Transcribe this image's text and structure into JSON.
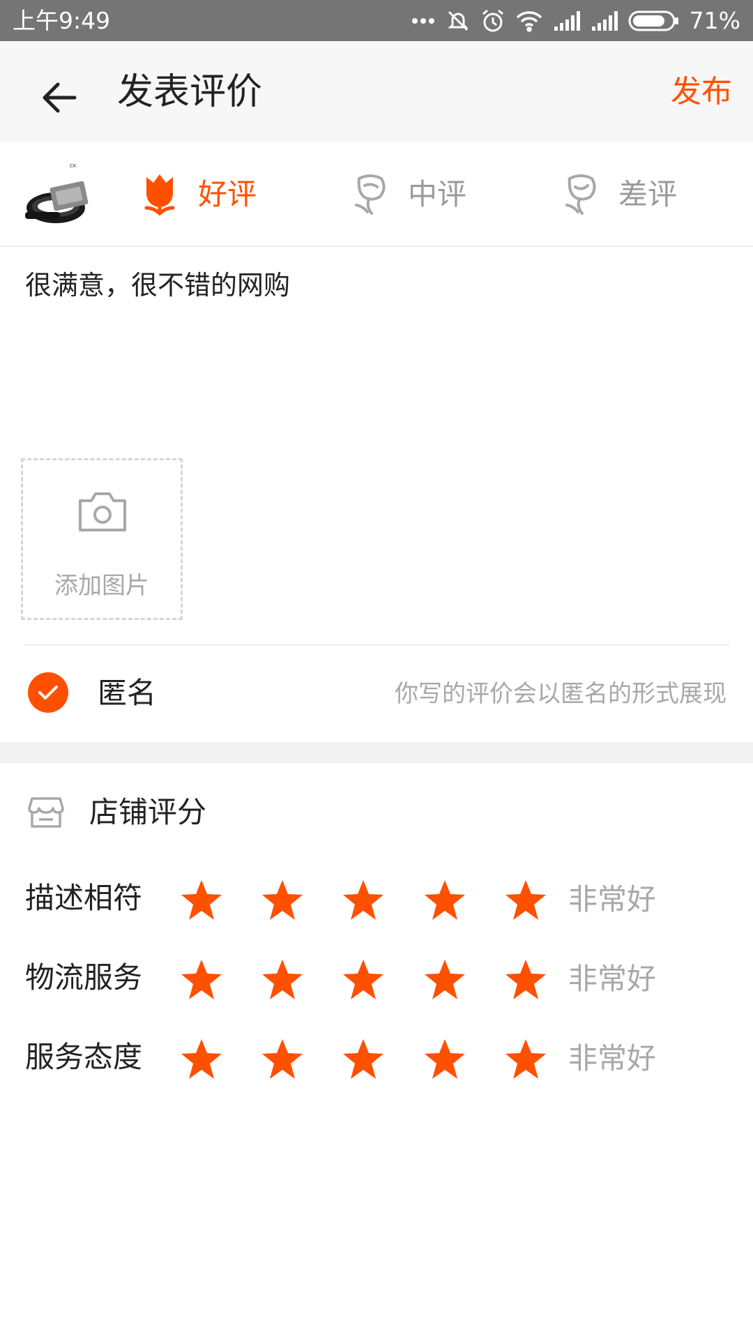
{
  "status_bar": {
    "time": "上午9:49",
    "battery": "71%",
    "icons": [
      "more-dots-icon",
      "mute-bell-icon",
      "alarm-icon",
      "wifi-icon",
      "signal-icon",
      "signal-icon",
      "battery-icon"
    ]
  },
  "header": {
    "title": "发表评价",
    "publish_label": "发布",
    "back_icon": "arrow-left-icon"
  },
  "rating_type": {
    "selected": "good",
    "good_label": "好评",
    "mid_label": "中评",
    "bad_label": "差评"
  },
  "product": {
    "image": "belt-product-thumbnail"
  },
  "comment": {
    "value": "很满意，很不错的网购"
  },
  "add_image": {
    "label": "添加图片"
  },
  "anonymous": {
    "checked": true,
    "label": "匿名",
    "hint": "你写的评价会以匿名的形式展现"
  },
  "shop_rating": {
    "title": "店铺评分",
    "items": [
      {
        "name": "描述相符",
        "stars": 5,
        "max": 5,
        "value_text": "非常好"
      },
      {
        "name": "物流服务",
        "stars": 5,
        "max": 5,
        "value_text": "非常好"
      },
      {
        "name": "服务态度",
        "stars": 5,
        "max": 5,
        "value_text": "非常好"
      }
    ]
  },
  "colors": {
    "accent": "#ff5000",
    "status_bar": "#757575",
    "header_bg": "#f7f7f7",
    "muted_text": "#a8a8a8"
  }
}
